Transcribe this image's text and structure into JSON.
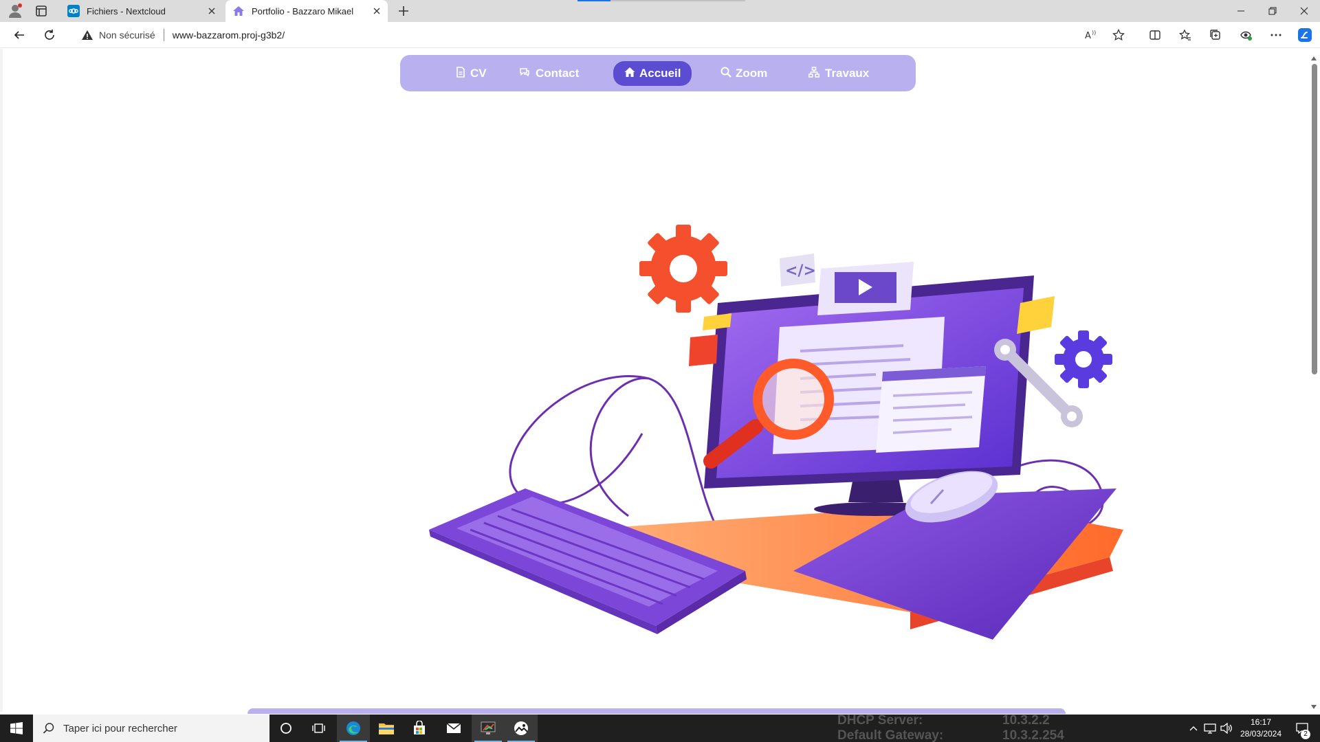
{
  "browser": {
    "tabs": [
      {
        "title": "Fichiers - Nextcloud",
        "active": false
      },
      {
        "title": "Portfolio - Bazzaro Mikael",
        "active": true
      }
    ],
    "address": {
      "security_label": "Non sécurisé",
      "url": "www-bazzarom.proj-g3b2/"
    }
  },
  "nav": {
    "items": [
      {
        "label": "CV",
        "icon": "document-icon",
        "active": false
      },
      {
        "label": "Contact",
        "icon": "chat-icon",
        "active": false
      },
      {
        "label": "Accueil",
        "icon": "home-icon",
        "active": true
      },
      {
        "label": "Zoom",
        "icon": "search-icon",
        "active": false
      },
      {
        "label": "Travaux",
        "icon": "sitemap-icon",
        "active": false
      }
    ]
  },
  "colors": {
    "nav_bg": "#b9b0ef",
    "nav_active": "#5b4cd1",
    "hero_purple": "#7b3fd6",
    "hero_orange": "#ff7a2f",
    "hero_red": "#f0432b"
  },
  "taskbar": {
    "search_placeholder": "Taper ici pour rechercher",
    "bginfo": [
      {
        "key": "DHCP Server:",
        "value": "10.3.2.2"
      },
      {
        "key": "Default Gateway:",
        "value": "10.3.2.254"
      }
    ],
    "clock_time": "16:17",
    "clock_date": "28/03/2024",
    "notification_count": "2"
  }
}
